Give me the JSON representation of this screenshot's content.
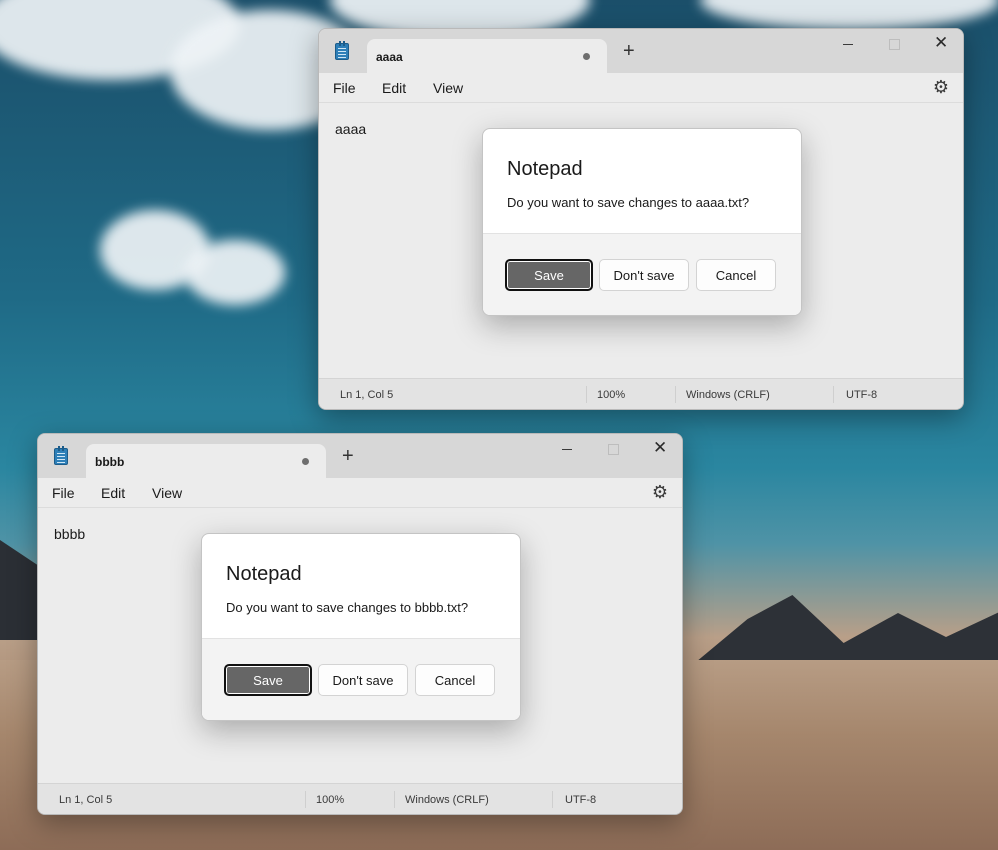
{
  "windows": [
    {
      "tab_title": "aaaa",
      "menu": {
        "file": "File",
        "edit": "Edit",
        "view": "View"
      },
      "content": "aaaa",
      "status": {
        "position": "Ln 1, Col 5",
        "zoom": "100%",
        "line_ending": "Windows (CRLF)",
        "encoding": "UTF-8"
      },
      "dialog": {
        "title": "Notepad",
        "message": "Do you want to save changes to aaaa.txt?",
        "save": "Save",
        "dont_save": "Don't save",
        "cancel": "Cancel"
      }
    },
    {
      "tab_title": "bbbb",
      "menu": {
        "file": "File",
        "edit": "Edit",
        "view": "View"
      },
      "content": "bbbb",
      "status": {
        "position": "Ln 1, Col 5",
        "zoom": "100%",
        "line_ending": "Windows (CRLF)",
        "encoding": "UTF-8"
      },
      "dialog": {
        "title": "Notepad",
        "message": "Do you want to save changes to bbbb.txt?",
        "save": "Save",
        "dont_save": "Don't save",
        "cancel": "Cancel"
      }
    }
  ],
  "icons": {
    "app": "notepad-icon",
    "new_tab": "+",
    "close": "✕",
    "settings": "⚙"
  },
  "colors": {
    "primary_button": "#666666",
    "window_bg": "#ececec",
    "titlebar_bg": "#d7d7d7"
  }
}
